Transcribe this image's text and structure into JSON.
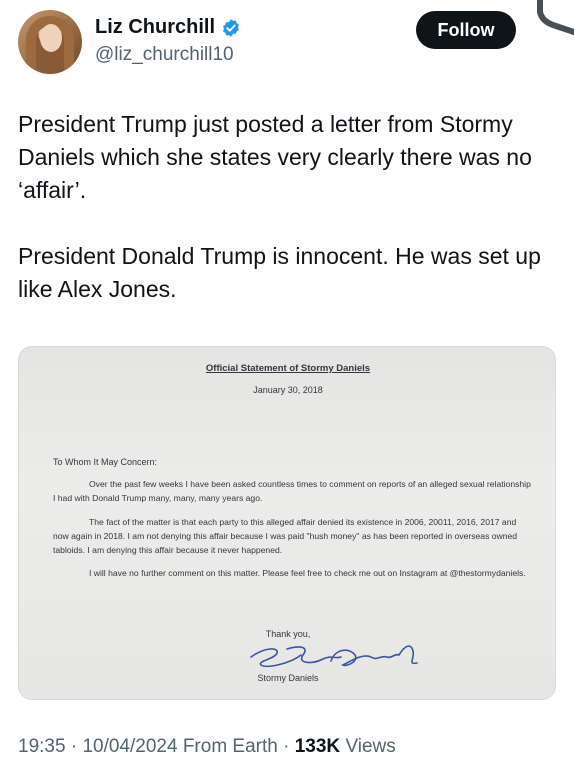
{
  "author": {
    "name": "Liz Churchill",
    "handle": "@liz_churchill10",
    "verified_icon": "verified-badge-icon",
    "avatar_icon": "profile-photo"
  },
  "follow_button": {
    "label": "Follow"
  },
  "tweet": {
    "paragraphs": [
      "President Trump just posted a letter from Stormy Daniels which she states very clearly there was no ‘affair’.",
      "President Donald Trump is innocent. He was set up like Alex Jones."
    ]
  },
  "letter": {
    "title": "Official Statement of Stormy Daniels",
    "date": "January 30, 2018",
    "greeting": "To Whom It May Concern:",
    "paragraphs": [
      "Over the past few weeks I have been asked countless times to comment on reports of an alleged sexual relationship I had with Donald Trump many, many, many years ago.",
      "The fact of the matter is that each party to this alleged affair denied its existence in 2006, 20011, 2016, 2017 and now again in 2018. I am not denying this affair because I was paid \"hush money\" as has been reported in overseas owned tabloids. I am denying this affair because it never happened.",
      "I will have no further comment on this matter. Please feel free to check me out on Instagram at @thestormydaniels."
    ],
    "closing": "Thank you,",
    "signature_name": "Stormy Daniels"
  },
  "meta": {
    "time": "19:35",
    "date": "10/04/2024",
    "source": "From Earth",
    "views_count": "133K",
    "views_label": "Views"
  },
  "colors": {
    "text": "#0f1419",
    "secondary": "#536471",
    "verified_blue": "#1d9bf0",
    "follow_bg": "#0f1419"
  }
}
